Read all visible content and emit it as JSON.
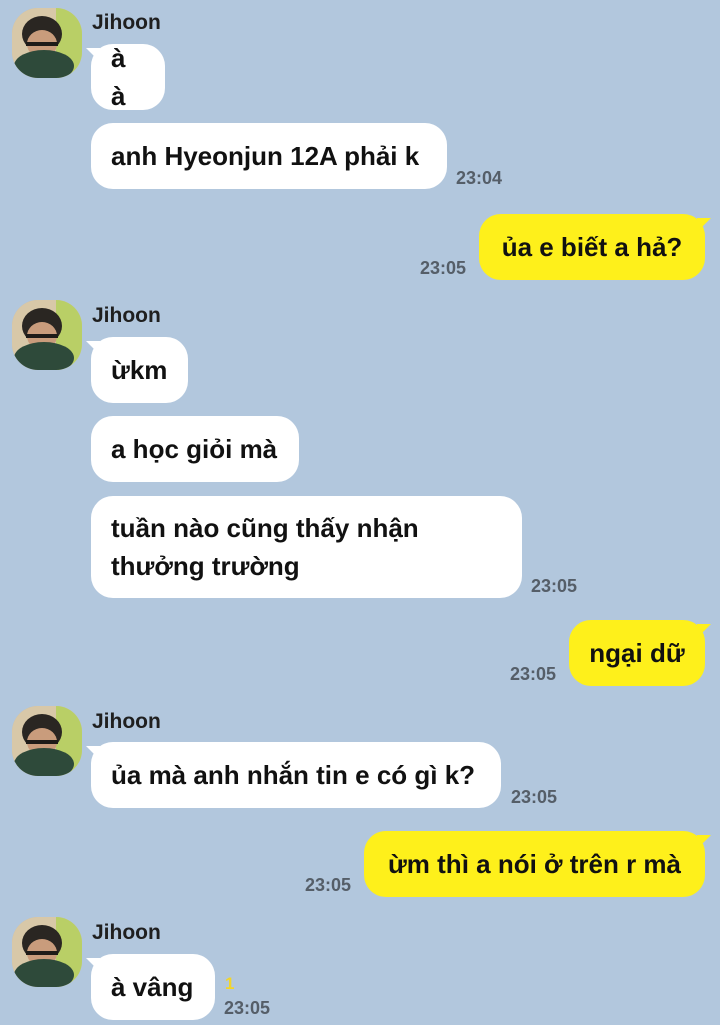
{
  "chat": {
    "contact_name": "Jihoon",
    "messages": [
      {
        "text": "à à"
      },
      {
        "text": "anh Hyeonjun 12A phải k",
        "time": "23:04"
      },
      {
        "text": "ủa e biết a hả?",
        "time": "23:05"
      },
      {
        "text": "ừkm"
      },
      {
        "text": "a học giỏi mà"
      },
      {
        "text": "tuần nào cũng thấy nhận thưởng trường",
        "time": "23:05"
      },
      {
        "text": "ngại dữ",
        "time": "23:05"
      },
      {
        "text": "ủa mà anh nhắn tin e có gì k?",
        "time": "23:05"
      },
      {
        "text": "ừm thì a nói ở trên r mà",
        "time": "23:05"
      },
      {
        "text": "à vâng",
        "time": "23:05",
        "unread": "1"
      }
    ]
  },
  "colors": {
    "background": "#b2c7dd",
    "incoming_bubble": "#ffffff",
    "outgoing_bubble": "#fef01b"
  },
  "icons": [
    "contact-avatar"
  ]
}
